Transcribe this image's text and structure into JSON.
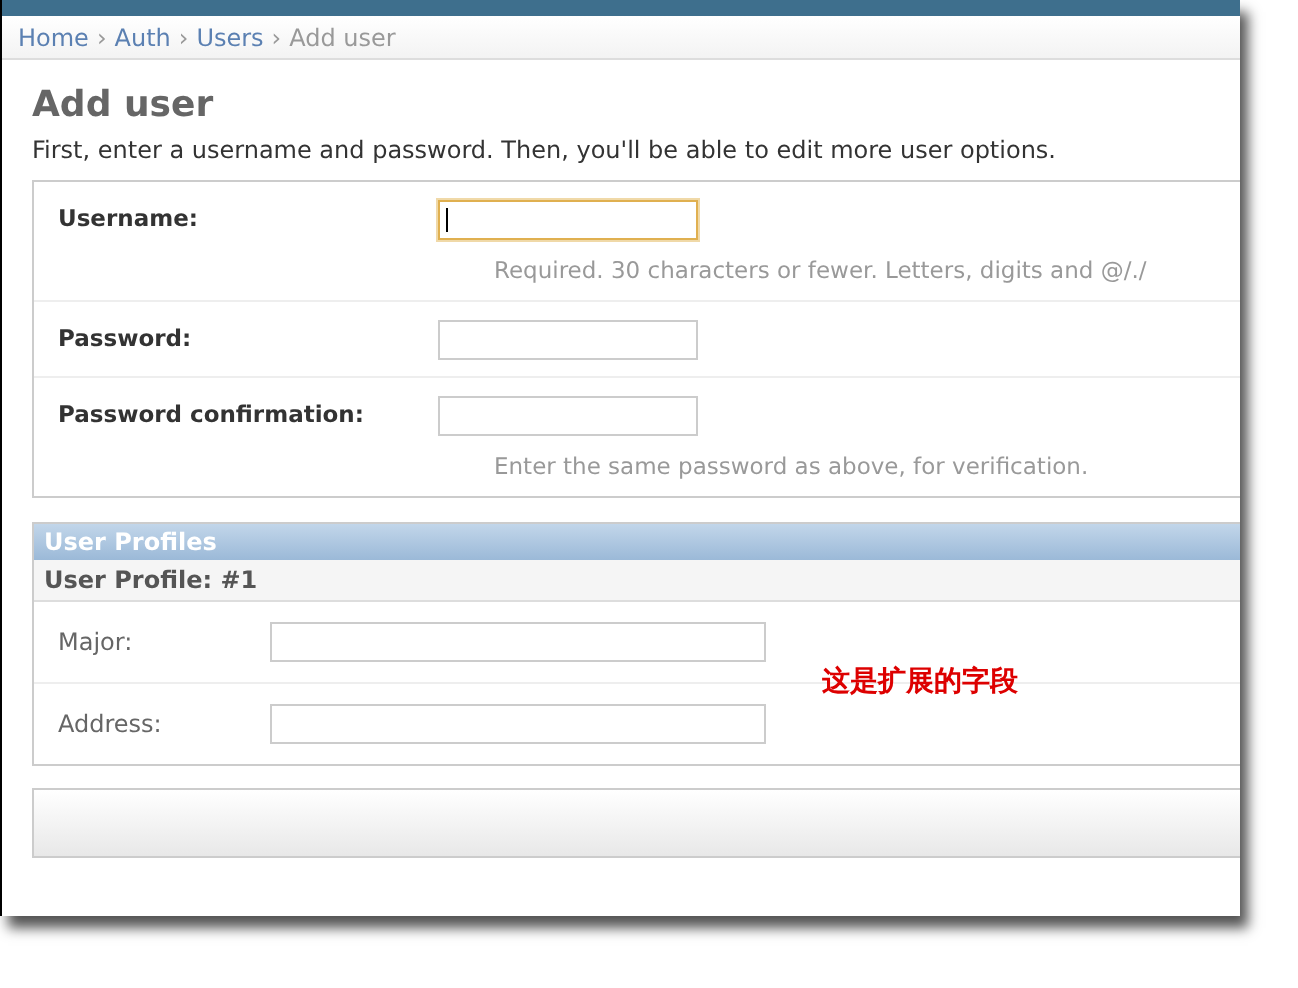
{
  "breadcrumbs": [
    {
      "label": "Home",
      "link": true
    },
    {
      "label": "Auth",
      "link": true
    },
    {
      "label": "Users",
      "link": true
    },
    {
      "label": "Add user",
      "link": false
    }
  ],
  "breadcrumb_separator": "›",
  "title": "Add user",
  "intro": "First, enter a username and password. Then, you'll be able to edit more user options.",
  "fields": [
    {
      "label": "Username:",
      "focused": true,
      "help": "Required. 30 characters or fewer. Letters, digits and @/./"
    },
    {
      "label": "Password:",
      "focused": false
    },
    {
      "label": "Password confirmation:",
      "focused": false,
      "help": "Enter the same password as above, for verification."
    }
  ],
  "inline_group": {
    "title": "User Profiles",
    "item_title": "User Profile: #1",
    "fields": [
      {
        "label": "Major:"
      },
      {
        "label": "Address:"
      }
    ]
  },
  "annotation": "这是扩展的字段"
}
